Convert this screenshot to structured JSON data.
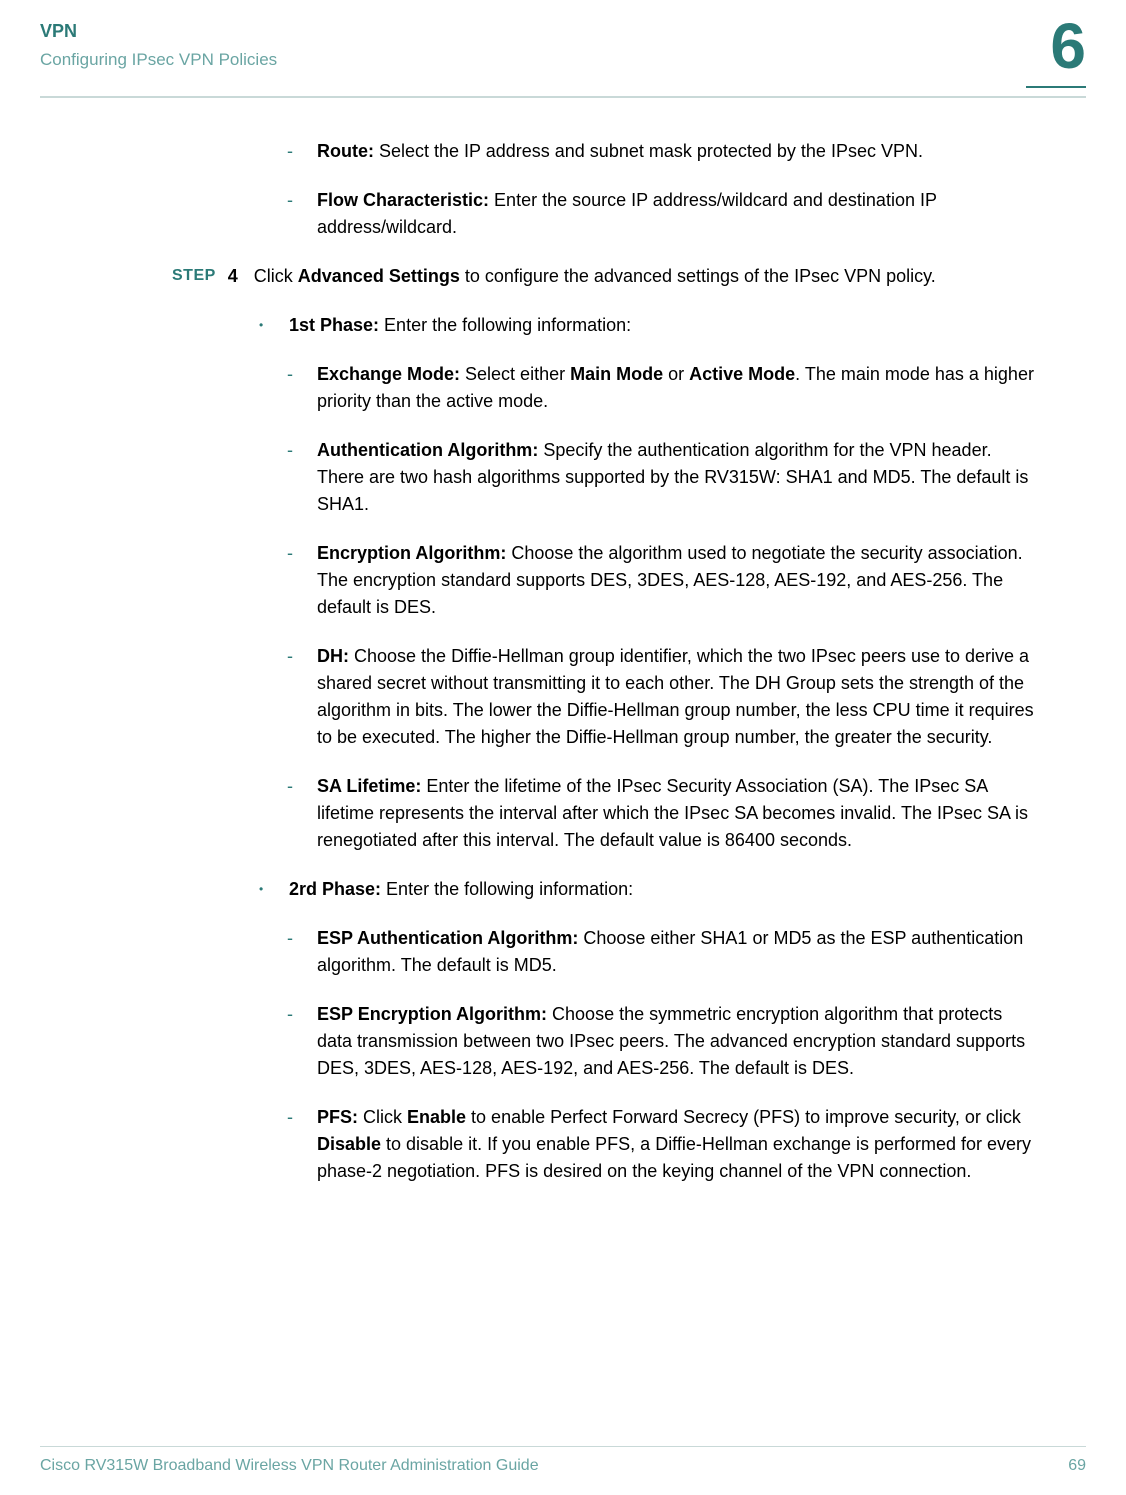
{
  "header": {
    "title": "VPN",
    "subtitle": "Configuring IPsec VPN Policies",
    "chapter": "6"
  },
  "intro_items": [
    {
      "bold": "Route:",
      "text": " Select the IP address and subnet mask protected by the IPsec VPN."
    },
    {
      "bold": "Flow Characteristic:",
      "text": " Enter the source IP address/wildcard and destination IP address/wildcard."
    }
  ],
  "step": {
    "label": "STEP",
    "num": "4",
    "pre": "Click ",
    "bold": "Advanced Settings",
    "post": " to configure the advanced settings of the IPsec VPN policy."
  },
  "phase1": {
    "bold": "1st Phase:",
    "text": " Enter the following information:",
    "items": [
      {
        "parts": [
          {
            "b": "Exchange Mode:"
          },
          {
            "t": " Select either "
          },
          {
            "b": "Main Mode"
          },
          {
            "t": " or "
          },
          {
            "b": "Active Mode"
          },
          {
            "t": ". The main mode has a higher priority than the active mode."
          }
        ]
      },
      {
        "parts": [
          {
            "b": "Authentication Algorithm:"
          },
          {
            "t": " Specify the authentication algorithm for the VPN header. There are two hash algorithms supported by the RV315W: SHA1 and MD5. The default is SHA1."
          }
        ]
      },
      {
        "parts": [
          {
            "b": "Encryption Algorithm:"
          },
          {
            "t": " Choose the algorithm used to negotiate the security association. The encryption standard supports DES, 3DES, AES-128, AES-192, and AES-256. The default is DES."
          }
        ]
      },
      {
        "parts": [
          {
            "b": "DH:"
          },
          {
            "t": " Choose the Diffie-Hellman group identifier, which the two IPsec peers use to derive a shared secret without transmitting it to each other. The DH Group sets the strength of the algorithm in bits. The lower the Diffie-Hellman group number, the less CPU time it requires to be executed. The higher the Diffie-Hellman group number, the greater the security."
          }
        ]
      },
      {
        "parts": [
          {
            "b": "SA Lifetime:"
          },
          {
            "t": " Enter the lifetime of the IPsec Security Association (SA). The IPsec SA lifetime represents the interval after which the IPsec SA becomes invalid. The IPsec SA is renegotiated after this interval. The default value is 86400 seconds."
          }
        ]
      }
    ]
  },
  "phase2": {
    "bold": "2rd Phase:",
    "text": " Enter the following information:",
    "items": [
      {
        "parts": [
          {
            "b": "ESP Authentication Algorithm:"
          },
          {
            "t": " Choose either SHA1 or MD5 as the ESP authentication algorithm. The default is MD5."
          }
        ]
      },
      {
        "parts": [
          {
            "b": "ESP Encryption Algorithm:"
          },
          {
            "t": " Choose the symmetric encryption algorithm that protects data transmission between two IPsec peers. The advanced encryption standard supports DES, 3DES, AES-128, AES-192, and AES-256. The default is DES."
          }
        ]
      },
      {
        "parts": [
          {
            "b": "PFS:"
          },
          {
            "t": " Click "
          },
          {
            "b": "Enable"
          },
          {
            "t": " to enable Perfect Forward Secrecy (PFS) to improve security, or click "
          },
          {
            "b": "Disable"
          },
          {
            "t": " to disable it. If you enable PFS, a Diffie-Hellman exchange is performed for every phase-2 negotiation. PFS is desired on the keying channel of the VPN connection."
          }
        ]
      }
    ]
  },
  "footer": {
    "left": "Cisco RV315W Broadband Wireless VPN Router Administration Guide",
    "right": "69"
  }
}
